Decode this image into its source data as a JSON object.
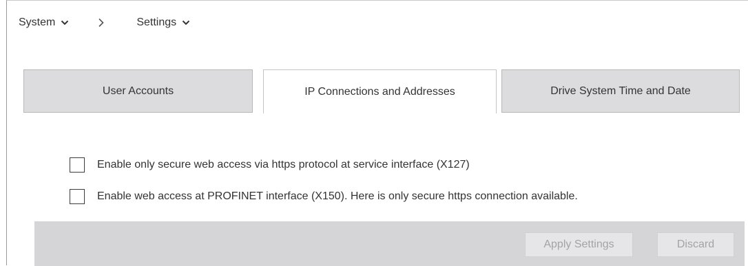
{
  "breadcrumb": {
    "items": [
      {
        "label": "System",
        "icon": "chevron-down-icon"
      },
      {
        "label": "Settings",
        "icon": "chevron-down-icon"
      }
    ],
    "separator_icon": "chevron-right-icon"
  },
  "tabs": [
    {
      "label": "User Accounts",
      "active": false
    },
    {
      "label": "IP Connections and Addresses",
      "active": true
    },
    {
      "label": "Drive System Time and Date",
      "active": false
    }
  ],
  "options": [
    {
      "label": "Enable only secure web access via https protocol at service interface (X127)",
      "checked": false
    },
    {
      "label": "Enable web access at PROFINET interface (X150). Here is only secure https connection available.",
      "checked": false
    }
  ],
  "actions": {
    "apply_label": "Apply Settings",
    "discard_label": "Discard",
    "enabled": false
  },
  "colors": {
    "tab_inactive_bg": "#dcdcde",
    "action_bar_bg": "#d5d5d8",
    "disabled_text": "#a3a3a6"
  }
}
